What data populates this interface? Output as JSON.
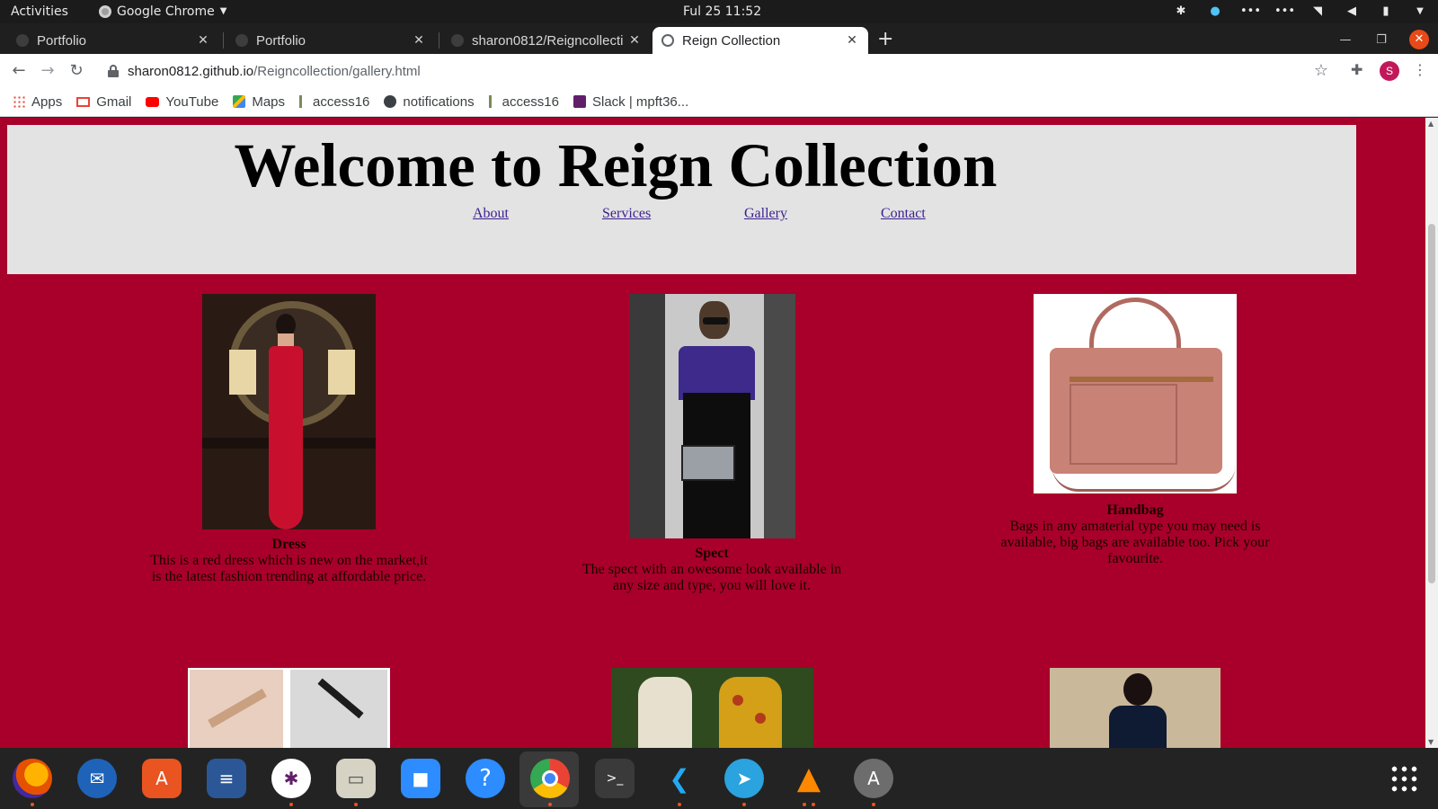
{
  "system_bar": {
    "activities": "Activities",
    "app_name": "Google Chrome",
    "clock": "Ful 25  11:52"
  },
  "tabs": [
    {
      "title": "Portfolio",
      "active": false
    },
    {
      "title": "Portfolio",
      "active": false
    },
    {
      "title": "sharon0812/Reigncollecti",
      "active": false
    },
    {
      "title": "Reign Collection",
      "active": true
    }
  ],
  "address_bar": {
    "url_host": "sharon0812.github.io",
    "url_path": "/Reigncollection/gallery.html",
    "profile_initial": "S"
  },
  "bookmarks": [
    "Apps",
    "Gmail",
    "YouTube",
    "Maps",
    "access16",
    "notifications",
    "access16",
    "Slack | mpft36..."
  ],
  "page": {
    "title": "Welcome to Reign Collection",
    "nav": [
      "About",
      "Services",
      "Gallery",
      "Contact"
    ],
    "background_color": "#a8002a",
    "header_color": "#e3e3e3",
    "gallery": [
      {
        "title": "Dress",
        "description_line1": "This is a red dress which is new on the market,it",
        "description_line2": "is the latest fashion trending at affordable price."
      },
      {
        "title": "Spect",
        "description_line1": "The spect with an owesome look available in",
        "description_line2": "any size and type, you will love it."
      },
      {
        "title": "Handbag",
        "description_line1": "Bags in any amaterial type you may need is",
        "description_line2": "available, big bags are available too. Pick your",
        "description_line3": "favourite."
      }
    ]
  },
  "dock": [
    "firefox-icon",
    "thunderbird-icon",
    "software-icon",
    "text-editor-icon",
    "slack-icon",
    "files-icon",
    "zoom-icon",
    "help-icon",
    "chrome-icon",
    "terminal-icon",
    "vscode-icon",
    "telegram-icon",
    "vlc-icon",
    "updater-icon"
  ]
}
